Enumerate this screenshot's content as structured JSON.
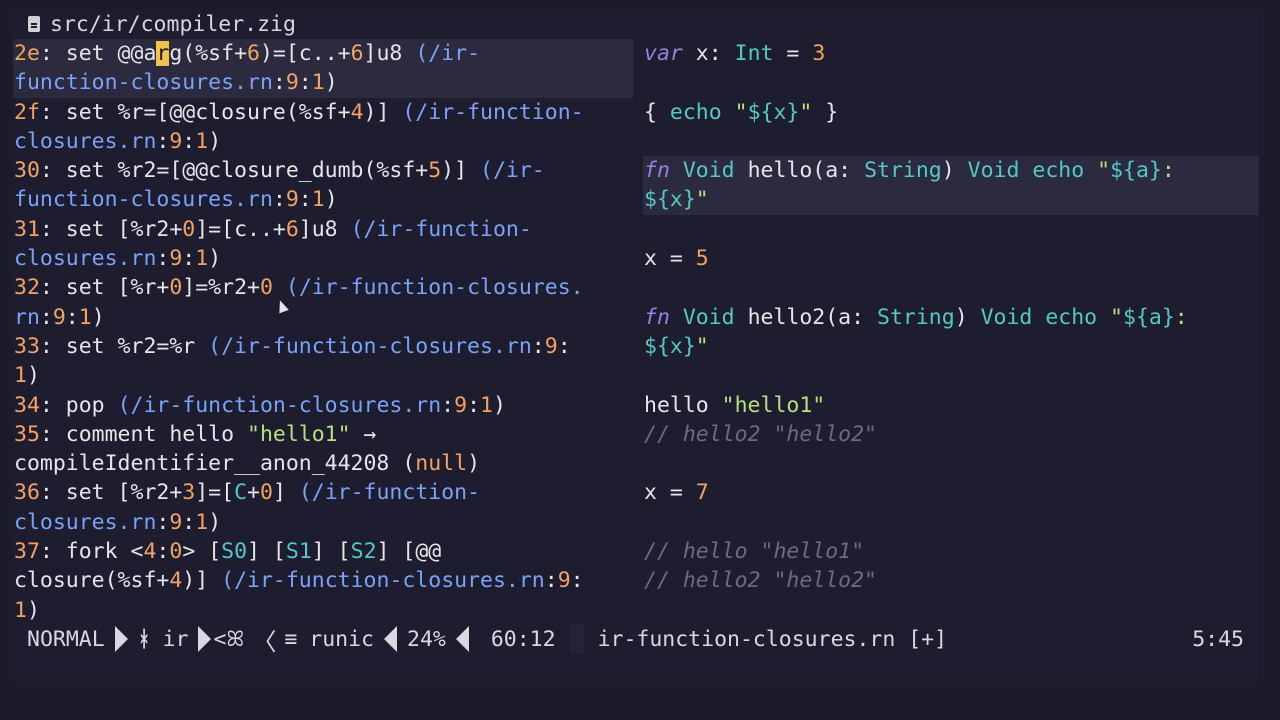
{
  "window": {
    "title": "src/ir/compiler.zig"
  },
  "status": {
    "mode": "NORMAL",
    "branch_icon": "git-branch-icon",
    "branch": "ir",
    "diff_glyph": "<ꕤ",
    "format_icon": "lines-icon",
    "filetype": "runic",
    "percent": "24%",
    "position": "60:12",
    "right_file": "ir-function-closures.rn [+]",
    "right_position": "5:45"
  }
}
